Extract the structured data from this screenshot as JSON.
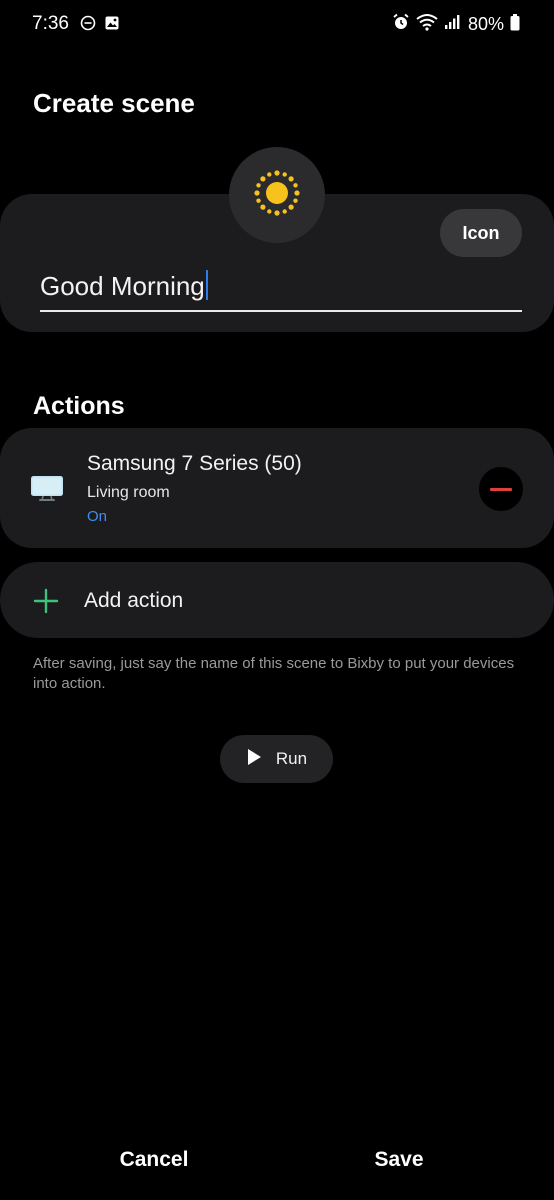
{
  "status_bar": {
    "time": "7:36",
    "icons_left": [
      "do-not-disturb-icon",
      "gallery-icon"
    ],
    "icons_right": [
      "alarm-icon",
      "wifi-icon",
      "signal-icon"
    ],
    "battery": "80%"
  },
  "page": {
    "title": "Create scene"
  },
  "scene": {
    "icon": "sun-icon",
    "icon_button_label": "Icon",
    "name_value": "Good Morning"
  },
  "actions": {
    "heading": "Actions",
    "items": [
      {
        "icon": "tv-icon",
        "device_name": "Samsung 7 Series (50)",
        "room": "Living room",
        "status": "On"
      }
    ],
    "add_label": "Add action"
  },
  "helper_text": "After saving, just say the name of this scene to Bixby to put your devices into action.",
  "run_label": "Run",
  "bottom_bar": {
    "cancel_label": "Cancel",
    "save_label": "Save"
  },
  "colors": {
    "background": "#000000",
    "card": "#1c1c1e",
    "accent_blue": "#3f8ef0",
    "remove_red": "#e0403a",
    "add_green": "#3ec27a",
    "sun_yellow": "#f7c21b"
  }
}
